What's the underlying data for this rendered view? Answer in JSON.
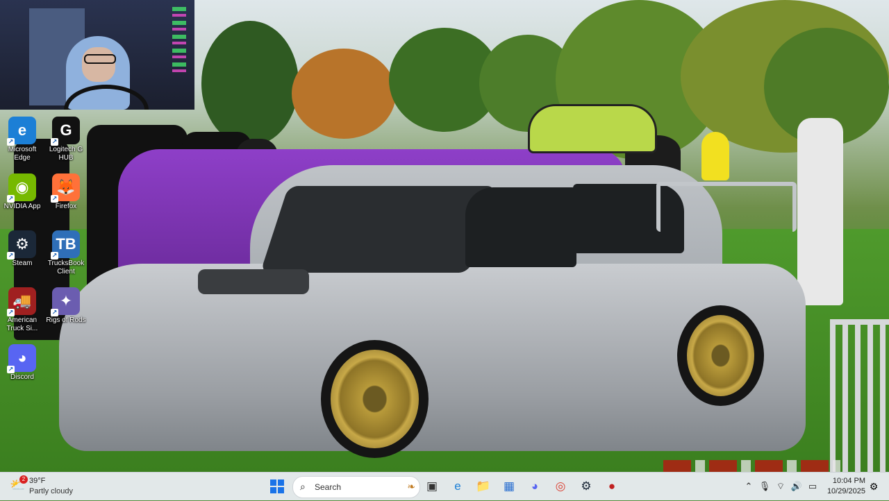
{
  "desktop": {
    "icons": [
      {
        "label": "Microsoft Edge",
        "icon": "edge-icon",
        "color": "#1c7fd6",
        "glyph": "e"
      },
      {
        "label": "Logitech G HUB",
        "icon": "logitech-icon",
        "color": "#111111",
        "glyph": "G"
      },
      {
        "label": "NVIDIA App",
        "icon": "nvidia-icon",
        "color": "#76b900",
        "glyph": "◉"
      },
      {
        "label": "Firefox",
        "icon": "firefox-icon",
        "color": "#ff7139",
        "glyph": "🦊"
      },
      {
        "label": "Steam",
        "icon": "steam-icon",
        "color": "#1b2838",
        "glyph": "⚙"
      },
      {
        "label": "TrucksBook Client",
        "icon": "trucksbook-icon",
        "color": "#2f6fb8",
        "glyph": "TB"
      },
      {
        "label": "American Truck Si...",
        "icon": "ats-icon",
        "color": "#a02020",
        "glyph": "🚚"
      },
      {
        "label": "Rigs of Rods",
        "icon": "rigs-of-rods-icon",
        "color": "#6b5db0",
        "glyph": "✦"
      },
      {
        "label": "Discord",
        "icon": "discord-icon",
        "color": "#5865f2",
        "glyph": "◕"
      }
    ]
  },
  "taskbar": {
    "weather": {
      "badge": "2",
      "temp": "39°F",
      "condition": "Partly cloudy",
      "icon": "partly-cloudy-icon"
    },
    "start_icon": "windows-start-icon",
    "search": {
      "label": "Search"
    },
    "pinned": [
      {
        "name": "task-view-icon",
        "glyph": "▣",
        "color": "#333333"
      },
      {
        "name": "edge-icon",
        "glyph": "e",
        "color": "#1c7fd6"
      },
      {
        "name": "file-explorer-icon",
        "glyph": "📁",
        "color": "#e8b83a"
      },
      {
        "name": "microsoft-store-icon",
        "glyph": "▦",
        "color": "#2a6fd0"
      },
      {
        "name": "discord-icon",
        "glyph": "◕",
        "color": "#5865f2"
      },
      {
        "name": "chrome-icon",
        "glyph": "◎",
        "color": "#db4437"
      },
      {
        "name": "steam-icon",
        "glyph": "⚙",
        "color": "#1b2838"
      },
      {
        "name": "app-icon",
        "glyph": "●",
        "color": "#c02020"
      }
    ],
    "tray": [
      {
        "name": "chevron-up-icon",
        "glyph": "⌃"
      },
      {
        "name": "microphone-icon",
        "glyph": "🎙"
      },
      {
        "name": "wifi-icon",
        "glyph": "⌔"
      },
      {
        "name": "volume-icon",
        "glyph": "🔊"
      },
      {
        "name": "battery-icon",
        "glyph": "▭"
      }
    ],
    "clock": {
      "time": "10:04 PM",
      "date": "10/29/2025"
    },
    "notifications_icon": "notification-bell-icon"
  }
}
